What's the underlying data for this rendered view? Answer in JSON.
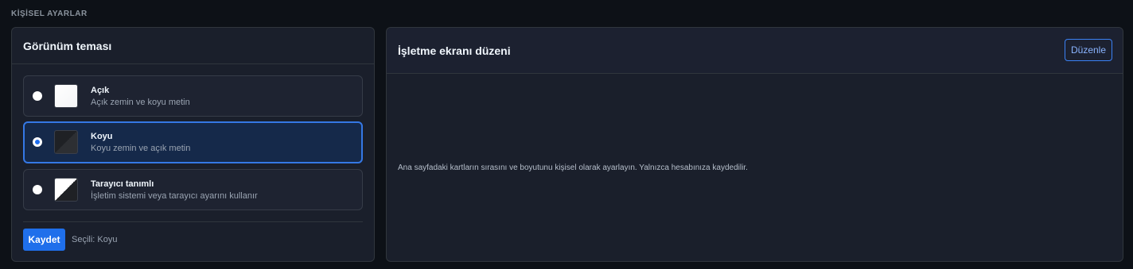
{
  "section": {
    "title": "KİŞİSEL AYARLAR"
  },
  "theme_card": {
    "title": "Görünüm teması",
    "options": [
      {
        "label": "Açık",
        "description": "Açık zemin ve koyu metin",
        "selected": false,
        "swatch": "light"
      },
      {
        "label": "Koyu",
        "description": "Koyu zemin ve açık metin",
        "selected": true,
        "swatch": "dark"
      },
      {
        "label": "Tarayıcı tanımlı",
        "description": "İşletim sistemi veya tarayıcı ayarını kullanır",
        "selected": false,
        "swatch": "system"
      }
    ],
    "save_label": "Kaydet",
    "selected_text": "Seçili: Koyu"
  },
  "layout_card": {
    "title": "İşletme ekranı düzeni",
    "edit_label": "Düzenle",
    "description": "Ana sayfadaki kartların sırasını ve boyutunu kişisel olarak ayarlayın. Yalnızca hesabınıza kaydedilir."
  },
  "colors": {
    "background": "#0d1117",
    "card": "#1a1f2b",
    "accent": "#1f6feb",
    "selected_border": "#3578e5"
  }
}
